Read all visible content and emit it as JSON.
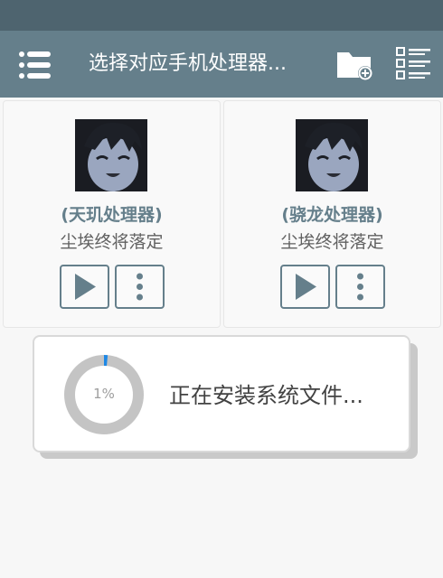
{
  "toolbar": {
    "title": "选择对应手机处理器...",
    "menu_icon": "menu-icon",
    "folder_icon": "folder-add-icon",
    "list_icon": "checklist-icon"
  },
  "cards": [
    {
      "name": "(天玑处理器)",
      "desc": "尘埃终将落定"
    },
    {
      "name": "(骁龙处理器)",
      "desc": "尘埃终将落定"
    }
  ],
  "dialog": {
    "progress": 1,
    "progress_label": "1%",
    "message": "正在安装系统文件..."
  },
  "colors": {
    "toolbar": "#657f8b",
    "status_bar": "#4e646f",
    "accent": "#657f8b",
    "progress": "#1e88e5"
  }
}
